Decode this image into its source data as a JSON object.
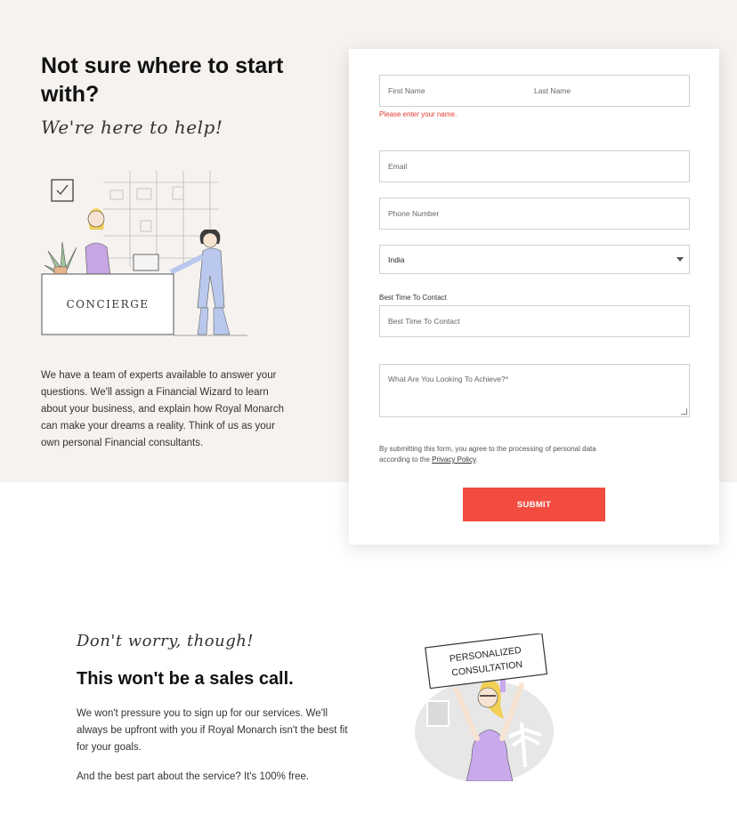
{
  "hero": {
    "heading": "Not sure where to start with?",
    "script": "We're here to help!",
    "illustration_label": "CONCIERGE",
    "intro": "We have a team of experts available to answer your questions. We'll assign a Financial Wizard to learn about your business, and explain how Royal Monarch can make your dreams a reality. Think of us as your own personal Financial consultants."
  },
  "form": {
    "first_name_placeholder": "First Name",
    "last_name_placeholder": "Last Name",
    "name_error": "Please enter your name.",
    "email_placeholder": "Email",
    "phone_placeholder": "Phone Number",
    "country_value": "India",
    "best_time_label": "Best Time To Contact",
    "best_time_placeholder": "Best Time To Contact",
    "goal_placeholder": "What Are You Looking To Achieve?*",
    "consent_text": "By submitting this form, you agree to the processing of personal data according to the ",
    "privacy_link": "Privacy Policy",
    "consent_end": ".",
    "submit_label": "SUBMIT"
  },
  "reassure": {
    "script": "Don't worry, though!",
    "heading": "This won't be a sales call.",
    "para1": "We won't pressure you to sign up for our services. We'll always be upfront with you if Royal Monarch isn't the best fit for your goals.",
    "para2": "And the best part about the service? It's 100% free.",
    "sign_line1": "PERSONALIZED",
    "sign_line2": "CONSULTATION"
  },
  "colors": {
    "accent": "#f24b3f",
    "hero_bg": "#f5f2ef",
    "error": "#e23b2e"
  }
}
